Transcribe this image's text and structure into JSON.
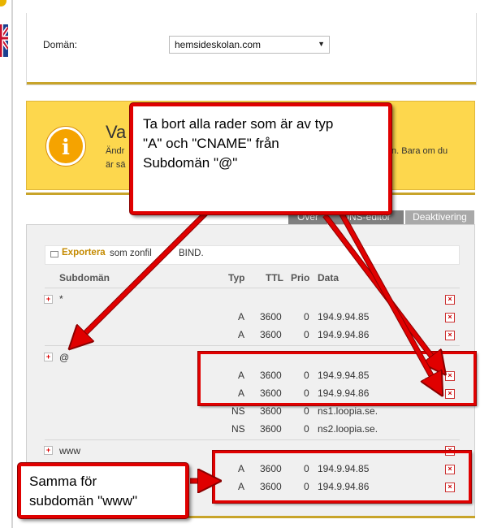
{
  "domain": {
    "label": "Domän:",
    "selected": "hemsideskolan.com"
  },
  "warning": {
    "title": "Va",
    "line1": "Ändr",
    "line1_right": "n. Bara om du",
    "line2": "är sä"
  },
  "tabs": [
    {
      "label": "Over",
      "active": false
    },
    {
      "label": "DNS-editor",
      "active": false
    },
    {
      "label": "Deaktivering",
      "active": true
    }
  ],
  "export": {
    "link": "Exportera",
    "text": "som zonfil"
  },
  "export_suffix": "BIND.",
  "table": {
    "headers": {
      "subdomain": "Subdomän",
      "type": "Typ",
      "ttl": "TTL",
      "prio": "Prio",
      "data": "Data"
    },
    "groups": [
      {
        "subdomain": "*",
        "records": [
          {
            "type": "A",
            "ttl": "3600",
            "prio": "0",
            "data": "194.9.94.85"
          },
          {
            "type": "A",
            "ttl": "3600",
            "prio": "0",
            "data": "194.9.94.86"
          }
        ]
      },
      {
        "subdomain": "@",
        "records": [
          {
            "type": "A",
            "ttl": "3600",
            "prio": "0",
            "data": "194.9.94.85"
          },
          {
            "type": "A",
            "ttl": "3600",
            "prio": "0",
            "data": "194.9.94.86"
          },
          {
            "type": "NS",
            "ttl": "3600",
            "prio": "0",
            "data": "ns1.loopia.se."
          },
          {
            "type": "NS",
            "ttl": "3600",
            "prio": "0",
            "data": "ns2.loopia.se."
          }
        ]
      },
      {
        "subdomain": "www",
        "records": [
          {
            "type": "A",
            "ttl": "3600",
            "prio": "0",
            "data": "194.9.94.85"
          },
          {
            "type": "A",
            "ttl": "3600",
            "prio": "0",
            "data": "194.9.94.86"
          }
        ]
      }
    ]
  },
  "callouts": {
    "top": [
      "Ta bort alla rader som är av typ",
      "\"A\" och \"CNAME\" från",
      "Subdomän \"@\""
    ],
    "bottom": [
      "Samma för",
      "subdomän \"www\""
    ]
  },
  "icons": {
    "info": "info-icon",
    "add": "plus-icon",
    "delete": "delete-x-icon",
    "export": "export-icon",
    "dropdown": "chevron-down-icon"
  },
  "colors": {
    "accent_gold": "#c8a42a",
    "warning_bg": "#fdd74d",
    "annotation_red": "#e00000",
    "link": "#c48a00"
  }
}
